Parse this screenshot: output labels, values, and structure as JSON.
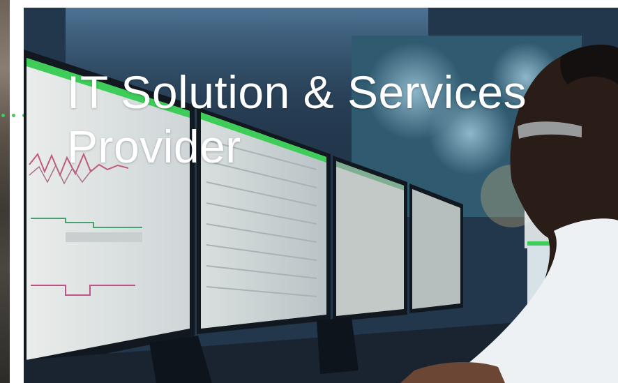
{
  "hero": {
    "title_line1": "IT Solution & Services",
    "title_line2": "Provider",
    "image": "man-monitoring-screens-in-control-room"
  },
  "colors": {
    "accent": "#3dcd58",
    "title": "#ffffff",
    "room": "#1f3349"
  }
}
